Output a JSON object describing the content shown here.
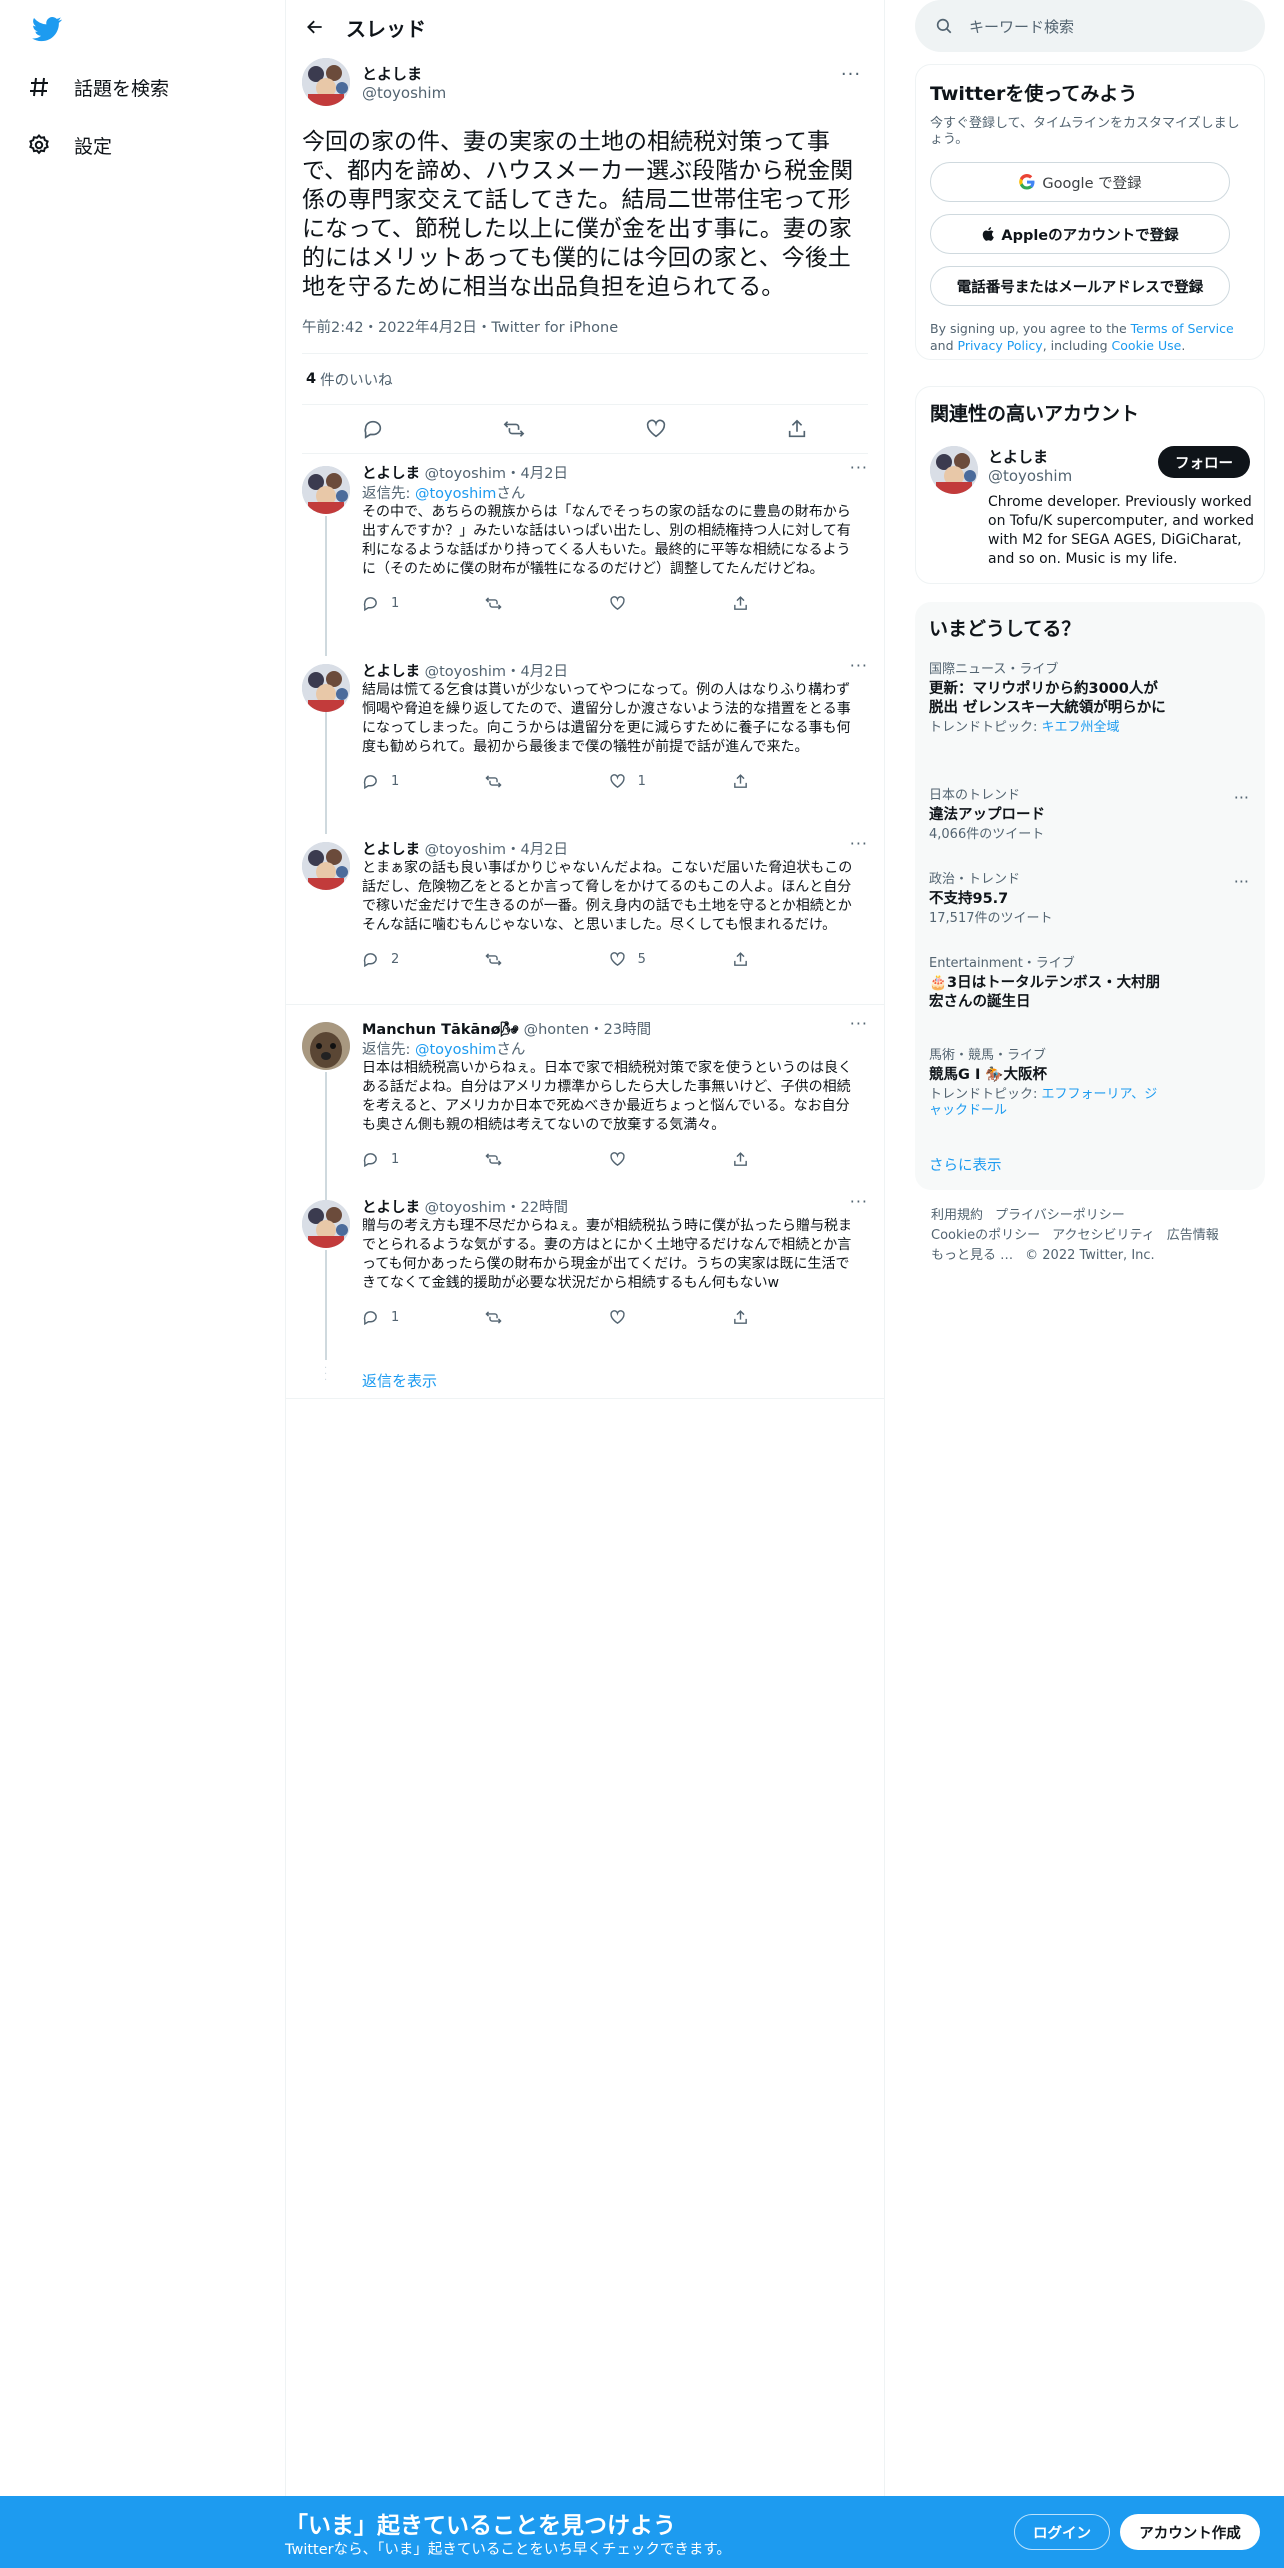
{
  "nav": {
    "explore_label": "話題を検索",
    "settings_label": "設定"
  },
  "header": {
    "title": "スレッド"
  },
  "focal": {
    "name": "とよしま",
    "handle": "@toyoshim",
    "text": "今回の家の件、妻の実家の土地の相続税対策って事で、都内を諦め、ハウスメーカー選ぶ段階から税金関係の専門家交えて話してきた。結局二世帯住宅って形になって、節税した以上に僕が金を出す事に。妻の家的にはメリットあっても僕的には今回の家と、今後土地を守るために相当な出品負担を迫られてる。",
    "meta": "午前2:42・2022年4月2日・Twitter for iPhone",
    "likes_count": "4",
    "likes_label": "件のいいね"
  },
  "replies": [
    {
      "name": "とよしま",
      "handle": "@toyoshim",
      "time": "4月2日",
      "reply_to_prefix": "返信先: ",
      "reply_to_handle": "@toyoshim",
      "reply_to_suffix": "さん",
      "text": "その中で、あちらの親族からは「なんでそっちの家の話なのに豊島の財布から出すんですか？」みたいな話はいっぱい出たし、別の相続権持つ人に対して有利になるような話ばかり持ってくる人もいた。最終的に平等な相続になるように（そのために僕の財布が犠牲になるのだけど）調整してたんだけどね。",
      "reply_count": "1",
      "retweet_count": "",
      "like_count": ""
    },
    {
      "name": "とよしま",
      "handle": "@toyoshim",
      "time": "4月2日",
      "text": "結局は慌てる乞食は貰いが少ないってやつになって。例の人はなりふり構わず恫喝や脅迫を繰り返してたので、遺留分しか渡さないよう法的な措置をとる事になってしまった。向こうからは遺留分を更に減らすために養子になる事も何度も勧められて。最初から最後まで僕の犠牲が前提で話が進んで来た。",
      "reply_count": "1",
      "retweet_count": "",
      "like_count": "1"
    },
    {
      "name": "とよしま",
      "handle": "@toyoshim",
      "time": "4月2日",
      "text": "とまぁ家の話も良い事ばかりじゃないんだよね。こないだ届いた脅迫状もこの話だし、危険物乙をとるとか言って脅しをかけてるのもこの人よ。ほんと自分で稼いだ金だけで生きるのが一番。例え身内の話でも土地を守るとか相続とかそんな話に噛むもんじゃないな、と思いました。尽くしても恨まれるだけ。",
      "reply_count": "2",
      "retweet_count": "",
      "like_count": "5"
    },
    {
      "name": "Manchun Tākānø🌬",
      "handle": "@honten",
      "time": "23時間",
      "reply_to_prefix": "返信先: ",
      "reply_to_handle": "@toyoshim",
      "reply_to_suffix": "さん",
      "text": "日本は相続税高いからねぇ。日本で家で相続税対策で家を使うというのは良くある話だよね。自分はアメリカ標準からしたら大した事無いけど、子供の相続を考えると、アメリカか日本で死ぬべきか最近ちょっと悩んでいる。なお自分も奥さん側も親の相続は考えてないので放棄する気満々。",
      "reply_count": "1",
      "retweet_count": "",
      "like_count": ""
    },
    {
      "name": "とよしま",
      "handle": "@toyoshim",
      "time": "22時間",
      "text": "贈与の考え方も理不尽だからねぇ。妻が相続税払う時に僕が払ったら贈与税までとられるような気がする。妻の方はとにかく土地守るだけなんで相続とか言っても何かあったら僕の財布から現金が出てくだけ。うちの実家は既に生活できてなくて金銭的援助が必要な状況だから相続するもん何もないw",
      "reply_count": "1",
      "retweet_count": "",
      "like_count": ""
    }
  ],
  "show_replies_label": "返信を表示",
  "search": {
    "placeholder": "キーワード検索"
  },
  "signup": {
    "title": "Twitterを使ってみよう",
    "subtitle": "今すぐ登録して、タイムラインをカスタマイズしましょう。",
    "google_label": "Google で登録",
    "apple_label": "Appleのアカウントで登録",
    "phone_label": "電話番号またはメールアドレスで登録",
    "terms_prefix": "By signing up, you agree to the ",
    "terms_link": "Terms of Service",
    "terms_and": " and ",
    "privacy_link": "Privacy Policy",
    "terms_including": ", including ",
    "cookie_link": "Cookie Use",
    "terms_end": "."
  },
  "related": {
    "title": "関連性の高いアカウント",
    "name": "とよしま",
    "handle": "@toyoshim",
    "follow_label": "フォロー",
    "bio": "Chrome developer. Previously worked on Tofu/K supercomputer, and worked with M2 for SEGA AGES, DiGiCharat, and so on. Music is my life."
  },
  "trends": {
    "title": "いまどうしてる？",
    "items": [
      {
        "context": "国際ニュース・ライブ",
        "name": "更新：マリウポリから約3000人が脱出 ゼレンスキー大統領が明らかに",
        "meta_prefix": "トレンドトピック: ",
        "meta_link": "キエフ州全域"
      },
      {
        "context": "日本のトレンド",
        "name": "違法アップロード",
        "meta": "4,066件のツイート"
      },
      {
        "context": "政治・トレンド",
        "name": "不支持95.7",
        "meta": "17,517件のツイート"
      },
      {
        "context": "Entertainment・ライブ",
        "name": "🎂3日はトータルテンボス・大村朋宏さんの誕生日"
      },
      {
        "context": "馬術・競馬・ライブ",
        "name": "競馬G I 🏇大阪杯",
        "meta_prefix": "トレンドトピック: ",
        "meta_link": "エフフォーリア、ジャックドール"
      }
    ],
    "show_more": "さらに表示"
  },
  "footer": {
    "terms": "利用規約",
    "privacy": "プライバシーポリシー",
    "cookie": "Cookieのポリシー",
    "accessibility": "アクセシビリティ",
    "ads": "広告情報",
    "more": "もっと見る …",
    "copyright": "© 2022 Twitter, Inc."
  },
  "banner": {
    "title": "「いま」起きていることを見つけよう",
    "subtitle": "Twitterなら、「いま」起きていることをいち早くチェックできます。",
    "login_label": "ログイン",
    "signup_label": "アカウント作成"
  },
  "colors": {
    "accent": "#1d9bf0",
    "text": "#0f1419",
    "muted": "#536471"
  }
}
